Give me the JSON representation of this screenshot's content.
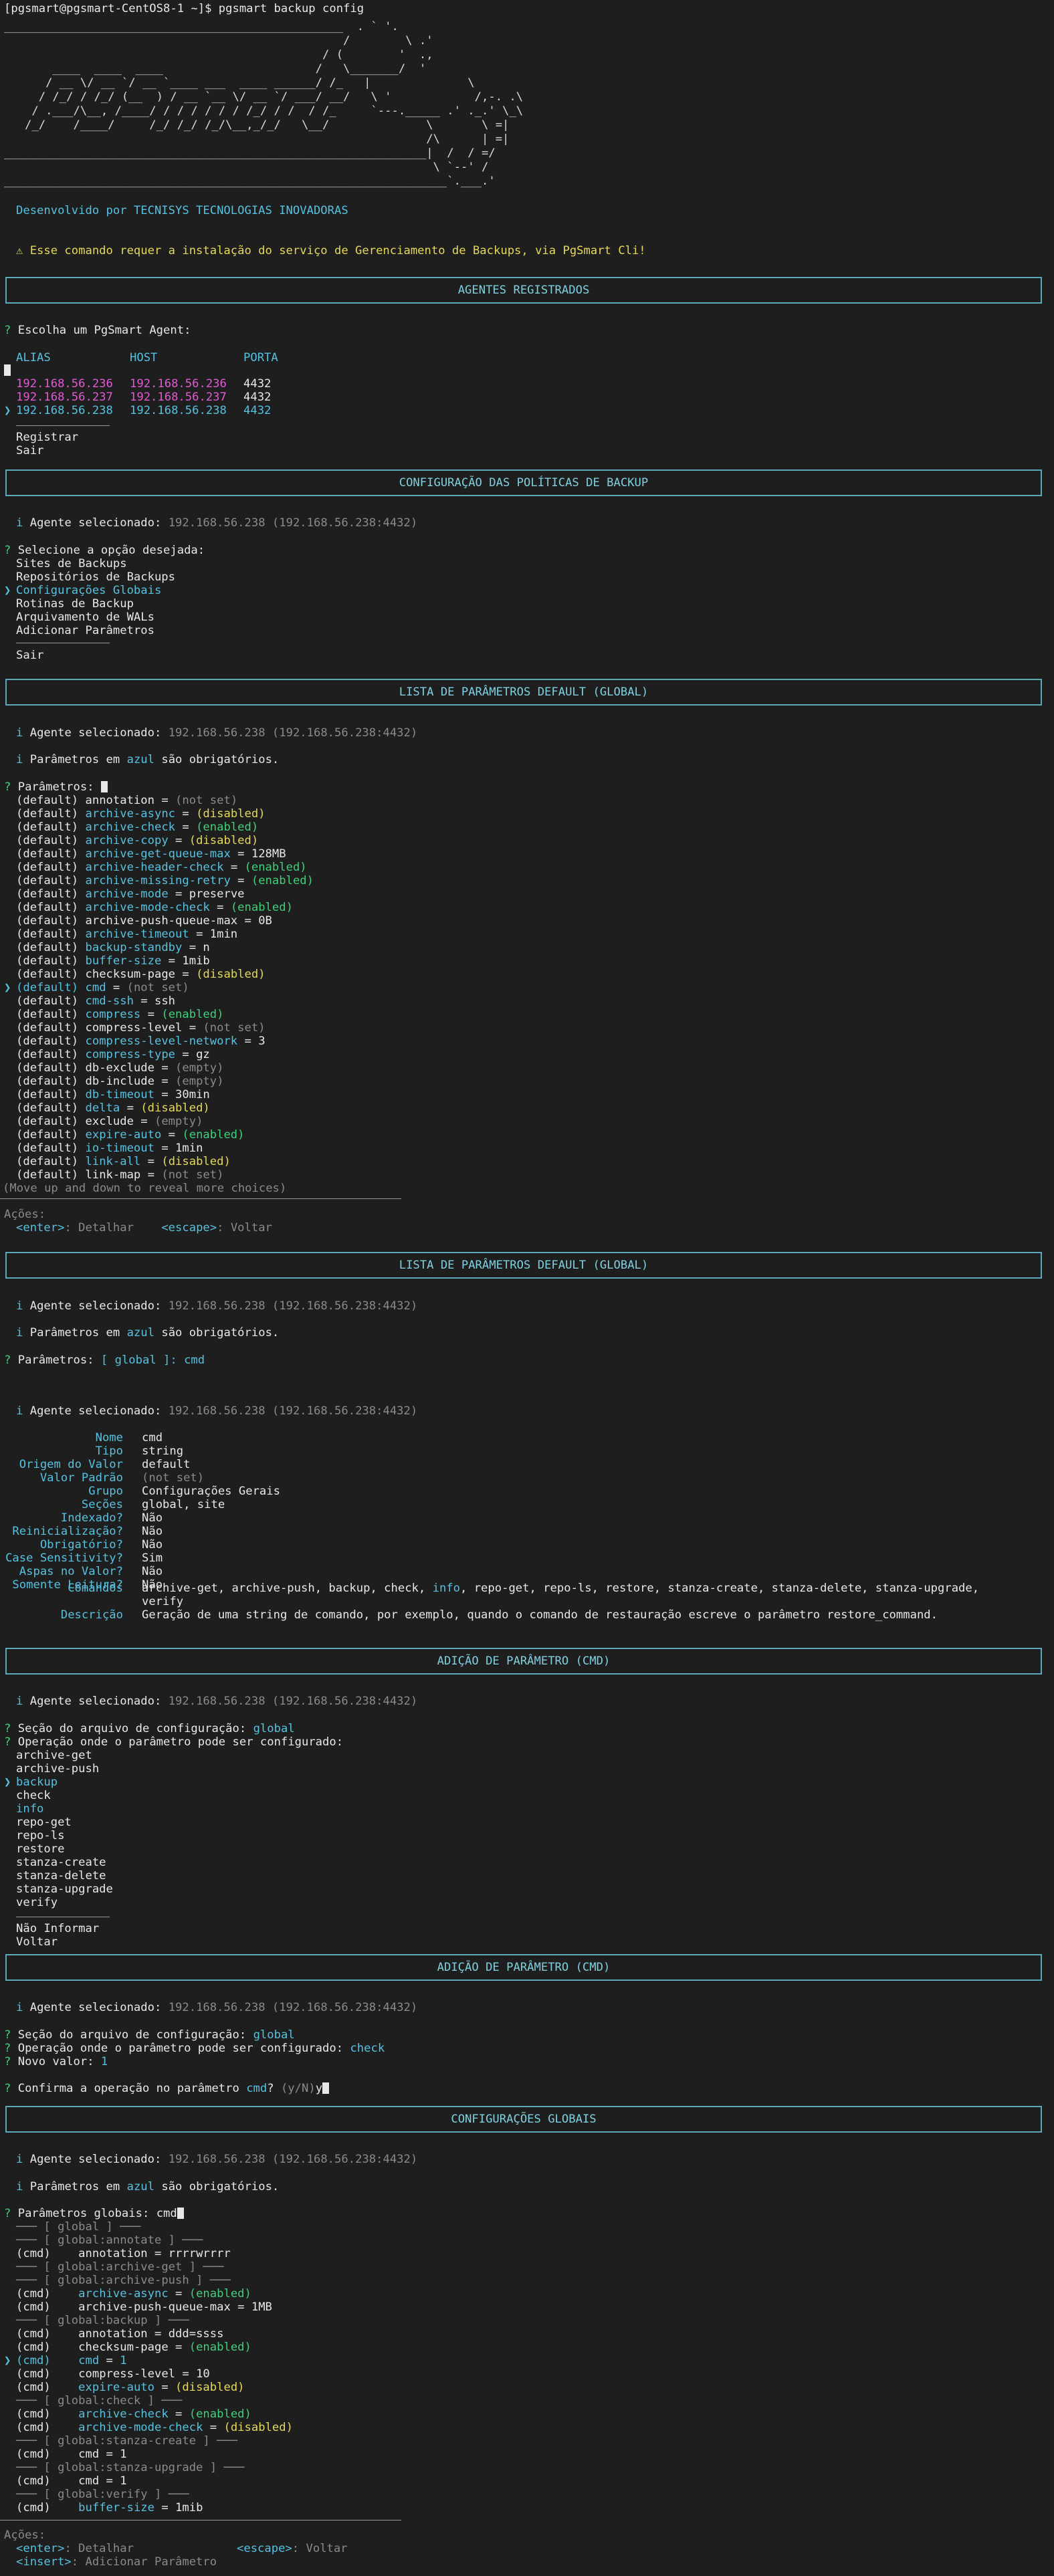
{
  "prompt": "[pgsmart@pgsmart-CentOS8-1 ~]$ pgsmart backup config",
  "logo_art": "_________________________________________________  . ` '.\n                                                 /        \\ .'\n                                              / (        '  .,\n       ____  ____  ____                      /   \\_______/  '\n      / __ \\/ __ `/ __ `____ ___  ____ ______/ /_   |              \\\n     / /_/ / /_/ (__  ) / __ `__ \\/ __ `/ ___/ __/   \\ '            /,-. .\\\n    / .___/\\__, /____/ / / / / / / /_/ / /  / /_     `---._____ .' ._.' \\_\\\n   /_/    /____/     /_/ /_/ /_/\\__,_/_/   \\__/              \\       \\ =|\n                                                             /\\      | =|\n_____________________________________________________________|  /  / =/\n                                                              \\ `--' /\n________________________________________________________________`.___.'",
  "dev": "Desenvolvido por TECNISYS TECNOLOGIAS INOVADORAS",
  "warn": "⚠ Esse comando requer a instalação do serviço de Gerenciamento de Backups, via PgSmart Cli!",
  "hdr1": "AGENTES REGISTRADOS",
  "agent_q": "Escolha um PgSmart Agent:",
  "cols": {
    "alias": "ALIAS",
    "host": "HOST",
    "porta": "PORTA"
  },
  "agents": [
    {
      "alias": "192.168.56.236",
      "host": "192.168.56.236",
      "port": "4432"
    },
    {
      "alias": "192.168.56.237",
      "host": "192.168.56.237",
      "port": "4432"
    },
    {
      "alias": "192.168.56.238",
      "host": "192.168.56.238",
      "port": "4432"
    }
  ],
  "agent_extra": [
    "Registrar",
    "Sair"
  ],
  "hdr2": "CONFIGURAÇÃO DAS POLÍTICAS DE BACKUP",
  "sel_label": "Agente selecionado:",
  "sel_val": "192.168.56.238 (192.168.56.238:4432)",
  "opt_q": "Selecione a opção desejada:",
  "opts": [
    "Sites de Backups",
    "Repositórios de Backups",
    "Configurações Globais",
    "Rotinas de Backup",
    "Arquivamento de WALs",
    "Adicionar Parâmetros"
  ],
  "opt_exit": "Sair",
  "hdr3": "LISTA DE PARÂMETROS DEFAULT (GLOBAL)",
  "req_a": "Parâmetros em ",
  "req_b": "azul",
  "req_c": " são obrigatórios.",
  "params_q": "Parâmetros:",
  "params": [
    {
      "t": "(default)",
      "n": "annotation",
      "r": false,
      "v": "(not set)",
      "k": "g"
    },
    {
      "t": "(default)",
      "n": "archive-async",
      "r": true,
      "v": "(disabled)",
      "k": "y"
    },
    {
      "t": "(default)",
      "n": "archive-check",
      "r": true,
      "v": "(enabled)",
      "k": "gr"
    },
    {
      "t": "(default)",
      "n": "archive-copy",
      "r": true,
      "v": "(disabled)",
      "k": "y"
    },
    {
      "t": "(default)",
      "n": "archive-get-queue-max",
      "r": true,
      "v": "128MB",
      "k": "w"
    },
    {
      "t": "(default)",
      "n": "archive-header-check",
      "r": true,
      "v": "(enabled)",
      "k": "gr"
    },
    {
      "t": "(default)",
      "n": "archive-missing-retry",
      "r": true,
      "v": "(enabled)",
      "k": "gr"
    },
    {
      "t": "(default)",
      "n": "archive-mode",
      "r": true,
      "v": "preserve",
      "k": "w"
    },
    {
      "t": "(default)",
      "n": "archive-mode-check",
      "r": true,
      "v": "(enabled)",
      "k": "gr"
    },
    {
      "t": "(default)",
      "n": "archive-push-queue-max",
      "r": false,
      "v": "0B",
      "k": "w"
    },
    {
      "t": "(default)",
      "n": "archive-timeout",
      "r": true,
      "v": "1min",
      "k": "w"
    },
    {
      "t": "(default)",
      "n": "backup-standby",
      "r": true,
      "v": "n",
      "k": "w"
    },
    {
      "t": "(default)",
      "n": "buffer-size",
      "r": true,
      "v": "1mib",
      "k": "w"
    },
    {
      "t": "(default)",
      "n": "checksum-page",
      "r": false,
      "v": "(disabled)",
      "k": "y"
    },
    {
      "t": "(default)",
      "n": "cmd",
      "r": false,
      "v": "(not set)",
      "k": "g",
      "sel": true
    },
    {
      "t": "(default)",
      "n": "cmd-ssh",
      "r": true,
      "v": "ssh",
      "k": "w"
    },
    {
      "t": "(default)",
      "n": "compress",
      "r": true,
      "v": "(enabled)",
      "k": "gr"
    },
    {
      "t": "(default)",
      "n": "compress-level",
      "r": false,
      "v": "(not set)",
      "k": "g"
    },
    {
      "t": "(default)",
      "n": "compress-level-network",
      "r": true,
      "v": "3",
      "k": "w"
    },
    {
      "t": "(default)",
      "n": "compress-type",
      "r": true,
      "v": "gz",
      "k": "w"
    },
    {
      "t": "(default)",
      "n": "db-exclude",
      "r": false,
      "v": "(empty)",
      "k": "g"
    },
    {
      "t": "(default)",
      "n": "db-include",
      "r": false,
      "v": "(empty)",
      "k": "g"
    },
    {
      "t": "(default)",
      "n": "db-timeout",
      "r": true,
      "v": "30min",
      "k": "w"
    },
    {
      "t": "(default)",
      "n": "delta",
      "r": true,
      "v": "(disabled)",
      "k": "y"
    },
    {
      "t": "(default)",
      "n": "exclude",
      "r": false,
      "v": "(empty)",
      "k": "g"
    },
    {
      "t": "(default)",
      "n": "expire-auto",
      "r": true,
      "v": "(enabled)",
      "k": "gr"
    },
    {
      "t": "(default)",
      "n": "io-timeout",
      "r": true,
      "v": "1min",
      "k": "w"
    },
    {
      "t": "(default)",
      "n": "link-all",
      "r": true,
      "v": "(disabled)",
      "k": "y"
    },
    {
      "t": "(default)",
      "n": "link-map",
      "r": false,
      "v": "(not set)",
      "k": "g"
    }
  ],
  "more": "(Move up and down to reveal more choices)",
  "acoes": "Ações:",
  "enter": "<enter>",
  "detalhar": ": Detalhar",
  "escape": "<escape>",
  "voltar": ": Voltar",
  "insert": "<insert>",
  "adicionar": ": Adicionar Parâmetro",
  "params_sel": "[ global ]: cmd",
  "detail": [
    {
      "k": "Nome",
      "v": "cmd",
      "c": "w"
    },
    {
      "k": "Tipo",
      "v": "string",
      "c": "w"
    },
    {
      "k": "Origem do Valor",
      "v": "default",
      "c": "w"
    },
    {
      "k": "Valor Padrão",
      "v": "(not set)",
      "c": "g"
    },
    {
      "k": "Grupo",
      "v": "Configurações Gerais",
      "c": "w"
    },
    {
      "k": "Seções",
      "v": "global, site",
      "c": "w"
    },
    {
      "k": "Indexado?",
      "v": "Não",
      "c": "w"
    },
    {
      "k": "Reinicialização?",
      "v": "Não",
      "c": "w"
    },
    {
      "k": "Obrigatório?",
      "v": "Não",
      "c": "w"
    },
    {
      "k": "Case Sensitivity?",
      "v": "Sim",
      "c": "w"
    },
    {
      "k": "Aspas no Valor?",
      "v": "Não",
      "c": "w"
    },
    {
      "k": "Somente Leitura?",
      "v": "Não",
      "c": "w"
    }
  ],
  "det_cmd_k": "Comandos",
  "det_cmd_a": "archive-get, archive-push, backup, check, ",
  "det_cmd_b": "info",
  "det_cmd_c": ", repo-get, repo-ls, restore, stanza-create, stanza-delete, stanza-upgrade,",
  "det_cmd_d": "verify",
  "det_desc_k": "Descrição",
  "det_desc_v": "Geração de uma string de comando, por exemplo, quando o comando de restauração escreve o parâmetro restore_command.",
  "hdr4": "ADIÇÃO DE PARÂMETRO (CMD)",
  "sec_q": "Seção do arquivo de configuração:",
  "sec_v": "global",
  "op_q": "Operação onde o parâmetro pode ser configurado:",
  "ops": [
    "archive-get",
    "archive-push",
    "backup",
    "check",
    "info",
    "repo-get",
    "repo-ls",
    "restore",
    "stanza-create",
    "stanza-delete",
    "stanza-upgrade",
    "verify"
  ],
  "ops_extra": [
    "Não Informar",
    "Voltar"
  ],
  "op_q2": "Operação onde o parâmetro pode ser configurado:",
  "op_v2": "check",
  "novo_q": "Novo valor:",
  "novo_v": "1",
  "conf_a": "Confirma a operação no parâmetro ",
  "conf_b": "cmd",
  "conf_c": "? ",
  "conf_d": "(y/N)",
  "conf_e": "y",
  "hdr5": "CONFIGURAÇÕES GLOBAIS",
  "pg_q": "Parâmetros globais:",
  "pg_v": "cmd",
  "globals": [
    {
      "kind": "sec",
      "text": "[ global ]"
    },
    {
      "kind": "sec",
      "text": "[ global:annotate ]"
    },
    {
      "kind": "p",
      "t": "(cmd)",
      "n": "annotation",
      "r": false,
      "v": "rrrrwrrrr",
      "k": "w"
    },
    {
      "kind": "sec",
      "text": "[ global:archive-get ]"
    },
    {
      "kind": "sec",
      "text": "[ global:archive-push ]"
    },
    {
      "kind": "p",
      "t": "(cmd)",
      "n": "archive-async",
      "r": true,
      "v": "(enabled)",
      "k": "gr"
    },
    {
      "kind": "p",
      "t": "(cmd)",
      "n": "archive-push-queue-max",
      "r": false,
      "v": "1MB",
      "k": "w"
    },
    {
      "kind": "sec",
      "text": "[ global:backup ]"
    },
    {
      "kind": "p",
      "t": "(cmd)",
      "n": "annotation",
      "r": false,
      "v": "ddd=ssss",
      "k": "w"
    },
    {
      "kind": "p",
      "t": "(cmd)",
      "n": "checksum-page",
      "r": false,
      "v": "(enabled)",
      "k": "gr"
    },
    {
      "kind": "p",
      "t": "(cmd)",
      "n": "cmd",
      "r": false,
      "v": "1",
      "k": "w",
      "sel": true
    },
    {
      "kind": "p",
      "t": "(cmd)",
      "n": "compress-level",
      "r": false,
      "v": "10",
      "k": "w"
    },
    {
      "kind": "p",
      "t": "(cmd)",
      "n": "expire-auto",
      "r": true,
      "v": "(disabled)",
      "k": "y"
    },
    {
      "kind": "sec",
      "text": "[ global:check ]"
    },
    {
      "kind": "p",
      "t": "(cmd)",
      "n": "archive-check",
      "r": true,
      "v": "(enabled)",
      "k": "gr"
    },
    {
      "kind": "p",
      "t": "(cmd)",
      "n": "archive-mode-check",
      "r": true,
      "v": "(disabled)",
      "k": "y"
    },
    {
      "kind": "sec",
      "text": "[ global:stanza-create ]"
    },
    {
      "kind": "p",
      "t": "(cmd)",
      "n": "cmd",
      "r": false,
      "v": "1",
      "k": "w"
    },
    {
      "kind": "sec",
      "text": "[ global:stanza-upgrade ]"
    },
    {
      "kind": "p",
      "t": "(cmd)",
      "n": "cmd",
      "r": false,
      "v": "1",
      "k": "w"
    },
    {
      "kind": "sec",
      "text": "[ global:verify ]"
    },
    {
      "kind": "p",
      "t": "(cmd)",
      "n": "buffer-size",
      "r": true,
      "v": "1mib",
      "k": "w"
    }
  ],
  "colors": {
    "bg": "#1e1e1e",
    "cyan": "#56c2e0",
    "yellow": "#e6d85a",
    "green": "#3fd07a",
    "magenta": "#e25ad4",
    "gray": "#8a8a8a",
    "border": "#5aa8b8"
  },
  "icons": {
    "question": "?",
    "info": "i",
    "pointer": "❯",
    "warning": "⚠"
  }
}
